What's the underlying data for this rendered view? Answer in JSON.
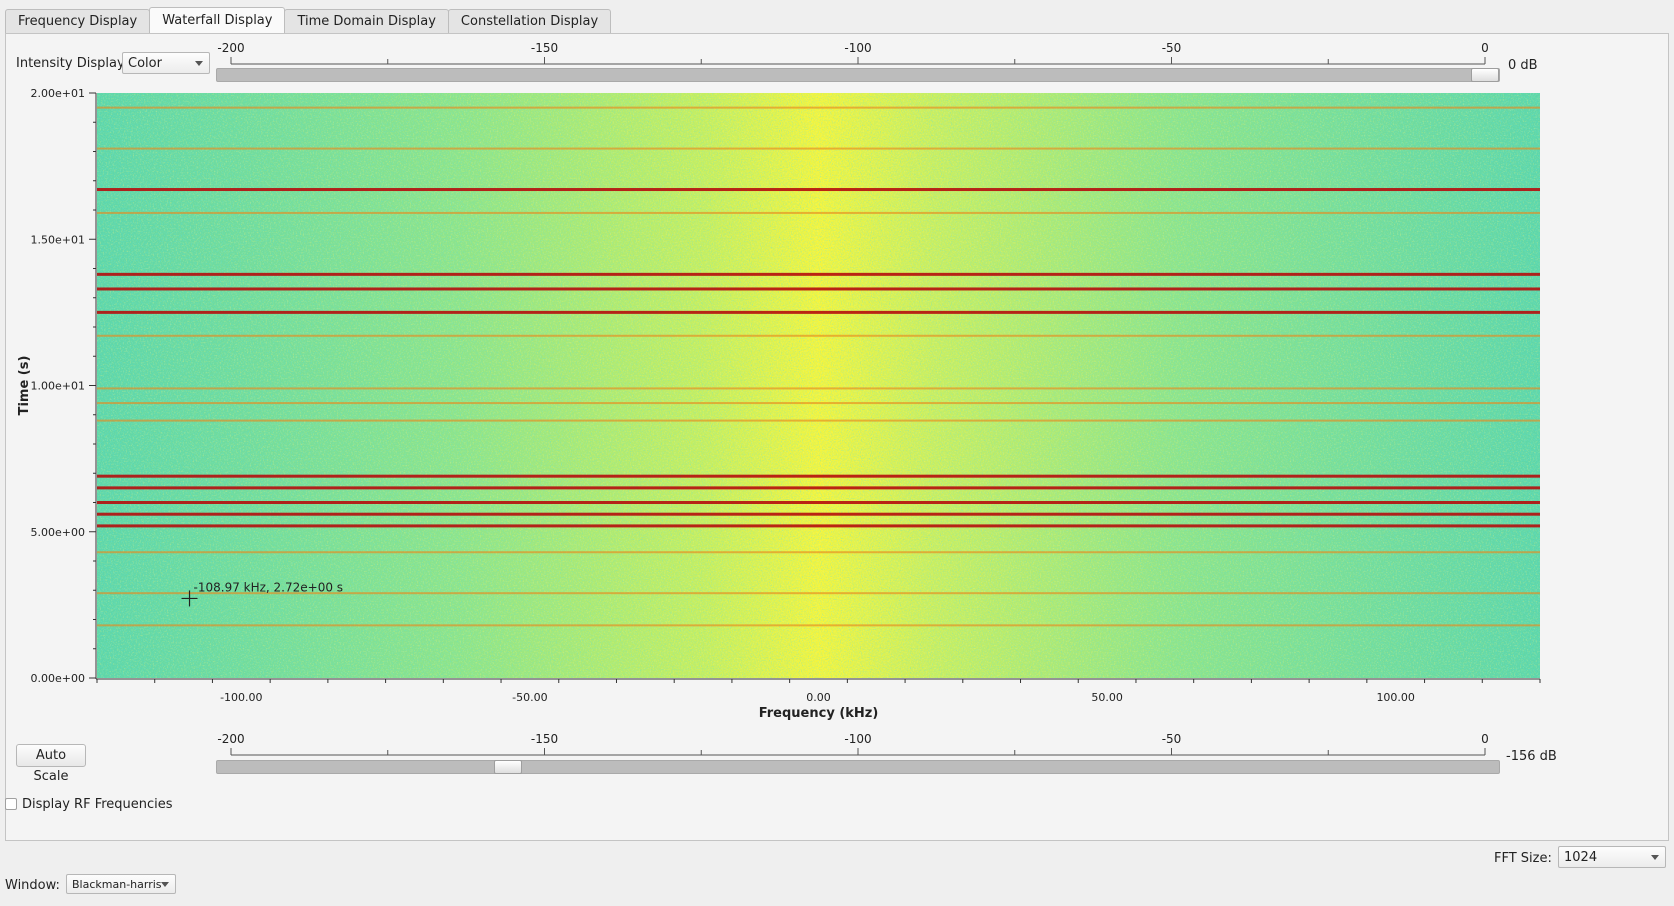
{
  "tabs": [
    {
      "label": "Frequency Display"
    },
    {
      "label": "Waterfall Display"
    },
    {
      "label": "Time Domain Display"
    },
    {
      "label": "Constellation Display"
    }
  ],
  "active_tab": 1,
  "intensity": {
    "label": "Intensity Display:",
    "value": "Color"
  },
  "top_scale": {
    "ticks": [
      "-200",
      "-150",
      "-100",
      "-50",
      "0"
    ],
    "unit_label": "0 dB",
    "value_db": 0,
    "min_db": -200,
    "max_db": 0
  },
  "bottom_scale": {
    "ticks": [
      "-200",
      "-150",
      "-100",
      "-50",
      "0"
    ],
    "unit_label": "-156 dB",
    "value_db": -156,
    "min_db": -200,
    "max_db": 0
  },
  "auto_scale_label": "Auto Scale",
  "display_rf_label": "Display RF Frequencies",
  "display_rf_checked": false,
  "fft_size": {
    "label": "FFT Size:",
    "value": "1024"
  },
  "window": {
    "label": "Window:",
    "value": "Blackman-harris"
  },
  "chart_data": {
    "type": "heatmap",
    "title": "",
    "xlabel": "Frequency (kHz)",
    "ylabel": "Time (s)",
    "xlim": [
      -125,
      125
    ],
    "ylim": [
      0,
      20
    ],
    "x_ticks": [
      -100,
      -50,
      0,
      50,
      100
    ],
    "x_tick_labels": [
      "-100.00",
      "-50.00",
      "0.00",
      "50.00",
      "100.00"
    ],
    "y_ticks": [
      0,
      5,
      10,
      15,
      20
    ],
    "y_tick_labels": [
      "0.00e+00",
      "5.00e+00",
      "1.00e+01",
      "1.50e+01",
      "2.00e+01"
    ],
    "cursor_readout": "-108.97 kHz, 2.72e+00 s",
    "cursor": {
      "freq_khz": -108.97,
      "time_s": 2.72
    },
    "colors": {
      "low": "#22c6c0",
      "mid": "#c7f05a",
      "high": "#ffee20",
      "peak": "#b50d0d"
    },
    "horizontal_bands_time_s": [
      19.5,
      18.1,
      16.7,
      15.9,
      13.8,
      13.3,
      12.5,
      11.7,
      9.9,
      9.4,
      8.8,
      6.9,
      6.5,
      6.0,
      5.6,
      5.2,
      4.3,
      2.9,
      1.8
    ]
  }
}
